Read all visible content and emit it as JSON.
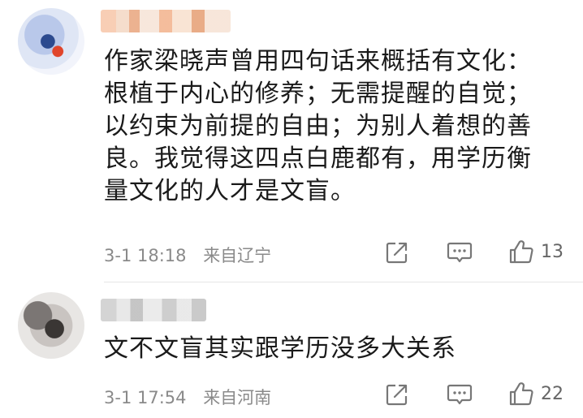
{
  "comments": [
    {
      "text": "作家梁晓声曾用四句话来概括有文化：根植于内心的修养；无需提醒的自觉；以约束为前提的自由；为别人着想的善良。我觉得这四点白鹿都有，用学历衡量文化的人才是文盲。",
      "lines": [
        "作家梁晓声曾用四句话来概括有文化：",
        "根植于内心的修养；无需提醒的自觉；",
        "以约束为前提的自由；为别人着想的善",
        "良。我觉得这四点白鹿都有，用学历衡",
        "量文化的人才是文盲。"
      ],
      "time": "3-1 18:18",
      "location": "来自辽宁",
      "likes": "13"
    },
    {
      "lines": [
        "文不文盲其实跟学历没多大关系"
      ],
      "time": "3-1 17:54",
      "location": "来自河南",
      "likes": "22"
    }
  ],
  "icons": {
    "share": "share-icon",
    "comment": "comment-icon",
    "like": "thumbs-up-icon"
  }
}
